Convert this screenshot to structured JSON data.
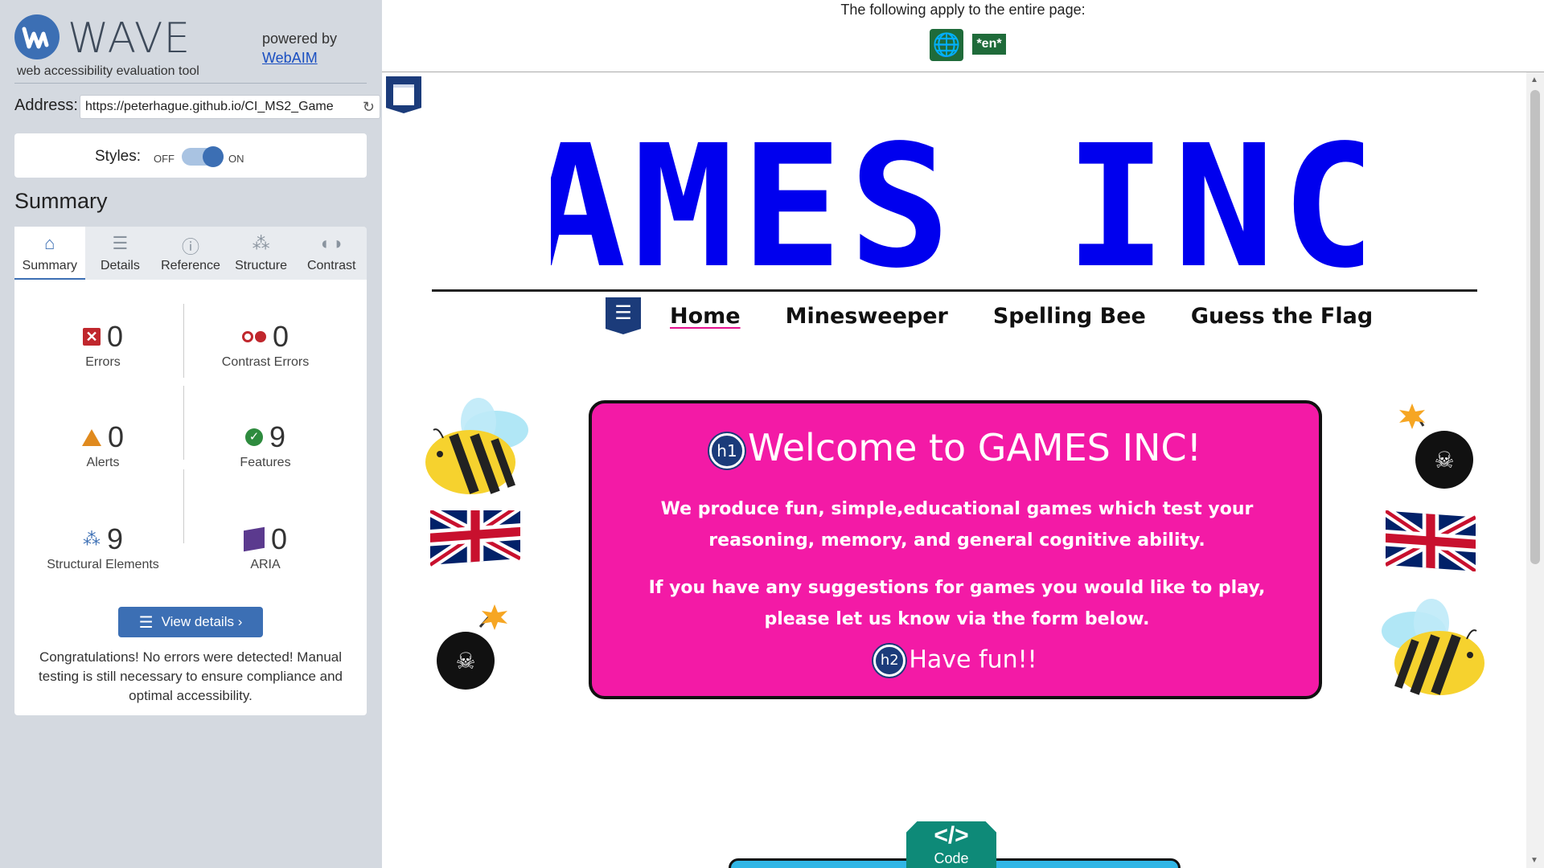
{
  "wave": {
    "logo_word": "WAVE",
    "tagline": "web accessibility evaluation tool",
    "powered_by": "powered by",
    "powered_link": "WebAIM",
    "address_label": "Address:",
    "address_value": "https://peterhague.github.io/CI_MS2_Game",
    "styles_label": "Styles:",
    "styles_off": "OFF",
    "styles_on": "ON",
    "styles_state": "on",
    "summary_title": "Summary",
    "tabs": [
      {
        "label": "Summary",
        "icon": "home-icon",
        "active": true
      },
      {
        "label": "Details",
        "icon": "list-icon",
        "active": false
      },
      {
        "label": "Reference",
        "icon": "info-icon",
        "active": false
      },
      {
        "label": "Structure",
        "icon": "hierarchy-icon",
        "active": false
      },
      {
        "label": "Contrast",
        "icon": "contrast-icon",
        "active": false
      }
    ],
    "stats": {
      "errors": {
        "value": "0",
        "label": "Errors"
      },
      "contrast_errors": {
        "value": "0",
        "label": "Contrast Errors"
      },
      "alerts": {
        "value": "0",
        "label": "Alerts"
      },
      "features": {
        "value": "9",
        "label": "Features"
      },
      "structural": {
        "value": "9",
        "label": "Structural Elements"
      },
      "aria": {
        "value": "0",
        "label": "ARIA"
      }
    },
    "view_details": "View details ›",
    "congrats": "Congratulations! No errors were detected! Manual testing is still necessary to ensure compliance and optimal accessibility.",
    "colors": {
      "accent": "#3c6fb4",
      "error": "#c0272d",
      "alert": "#e08a1e",
      "feature": "#2e8b3e",
      "aria": "#5b3a8e",
      "sidebar_bg": "#d4d9e0"
    }
  },
  "topbar": {
    "apply_text": "The following apply to the entire page:",
    "globe_icon": "globe-icon",
    "lang_badge": "*en*"
  },
  "site": {
    "title": "GAMES INC.",
    "nav": [
      {
        "label": "Home",
        "active": true
      },
      {
        "label": "Minesweeper",
        "active": false
      },
      {
        "label": "Spelling Bee",
        "active": false
      },
      {
        "label": "Guess the Flag",
        "active": false
      }
    ],
    "hero": {
      "h1_badge": "h1",
      "h1": "Welcome to GAMES INC!",
      "p1": "We produce fun, simple,educational games which test your reasoning, memory, and general cognitive ability.",
      "p2": "If you have any suggestions for games you would like to play, please let us know via the form below.",
      "h2_badge": "h2",
      "h2": "Have fun!!"
    },
    "code_tab": {
      "symbol": "</>",
      "label": "Code"
    },
    "colors": {
      "title_blue": "#0000ee",
      "hero_pink": "#f31aa6",
      "nav_underline": "#e5128f",
      "code_teal": "#0e8a78",
      "bottom_box": "#31b6e6"
    }
  }
}
